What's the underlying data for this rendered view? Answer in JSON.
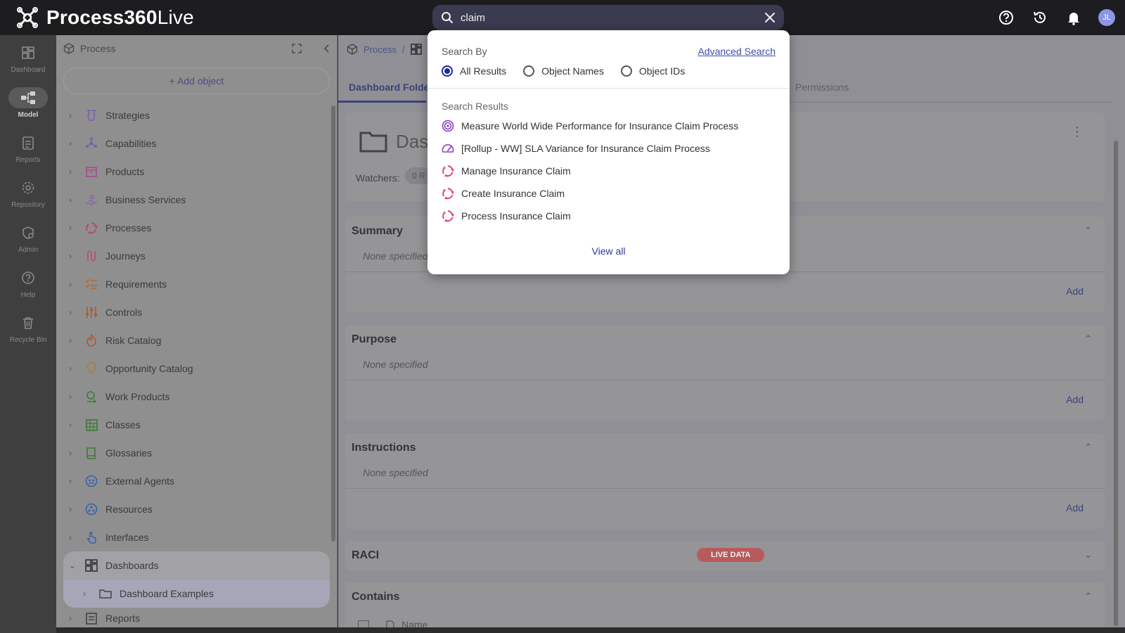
{
  "app": {
    "name_bold": "Process360",
    "name_light": "Live"
  },
  "search": {
    "value": "claim",
    "placeholder": ""
  },
  "user": {
    "initials": "JL"
  },
  "rail": [
    {
      "label": "Dashboard",
      "icon": "dashboard-icon"
    },
    {
      "label": "Model",
      "icon": "model-icon"
    },
    {
      "label": "Reports",
      "icon": "reports-icon"
    },
    {
      "label": "Repository",
      "icon": "repository-icon"
    },
    {
      "label": "Admin",
      "icon": "admin-icon"
    },
    {
      "label": "Help",
      "icon": "help-icon"
    },
    {
      "label": "Recycle Bin",
      "icon": "recycle-bin-icon"
    }
  ],
  "tree": {
    "title": "Process",
    "add_label": "+ Add object",
    "items": [
      {
        "label": "Strategies",
        "color": "#8a6fc4"
      },
      {
        "label": "Capabilities",
        "color": "#8a6fc4"
      },
      {
        "label": "Products",
        "color": "#b85b9a"
      },
      {
        "label": "Business Services",
        "color": "#9b6fc4"
      },
      {
        "label": "Processes",
        "color": "#c45b7a"
      },
      {
        "label": "Journeys",
        "color": "#c45b7a"
      },
      {
        "label": "Requirements",
        "color": "#c47a3a"
      },
      {
        "label": "Controls",
        "color": "#c4663a"
      },
      {
        "label": "Risk Catalog",
        "color": "#c4663a"
      },
      {
        "label": "Opportunity Catalog",
        "color": "#c48a3a"
      },
      {
        "label": "Work Products",
        "color": "#4a8a4a"
      },
      {
        "label": "Classes",
        "color": "#4a8a4a"
      },
      {
        "label": "Glossaries",
        "color": "#4a8a4a"
      },
      {
        "label": "External Agents",
        "color": "#4a6fc4"
      },
      {
        "label": "Resources",
        "color": "#4a6fc4"
      },
      {
        "label": "Interfaces",
        "color": "#4a6fc4"
      },
      {
        "label": "Dashboards",
        "color": "#444"
      }
    ],
    "child": "Dashboard Examples",
    "partial": "Reports"
  },
  "main": {
    "crumb": "Process",
    "tab_active": "Dashboard Folde",
    "tab_permissions": "Permissions",
    "header_title_partial": "Das",
    "watchers_label": "Watchers:",
    "watchers_badge": "0 R",
    "sections": {
      "summary": "Summary",
      "purpose": "Purpose",
      "instructions": "Instructions",
      "raci": "RACI",
      "contains": "Contains"
    },
    "none": "None specified",
    "add": "Add",
    "live_data": "LIVE DATA",
    "contains_col": "Name"
  },
  "dropdown": {
    "search_by": "Search By",
    "advanced": "Advanced Search",
    "radios": [
      "All Results",
      "Object Names",
      "Object IDs"
    ],
    "results_label": "Search Results",
    "results": [
      {
        "label": "Measure World Wide Performance for Insurance Claim Process",
        "icon": "target-icon",
        "color": "#8a3fc4"
      },
      {
        "label": "[Rollup - WW] SLA Variance for Insurance Claim Process",
        "icon": "gauge-icon",
        "color": "#8a3fc4"
      },
      {
        "label": "Manage Insurance Claim",
        "icon": "process-cycle-icon",
        "color": "#e0457a"
      },
      {
        "label": "Create Insurance Claim",
        "icon": "process-cycle-icon",
        "color": "#e0457a"
      },
      {
        "label": "Process Insurance Claim",
        "icon": "process-cycle-icon",
        "color": "#e0457a"
      }
    ],
    "view_all": "View all"
  }
}
